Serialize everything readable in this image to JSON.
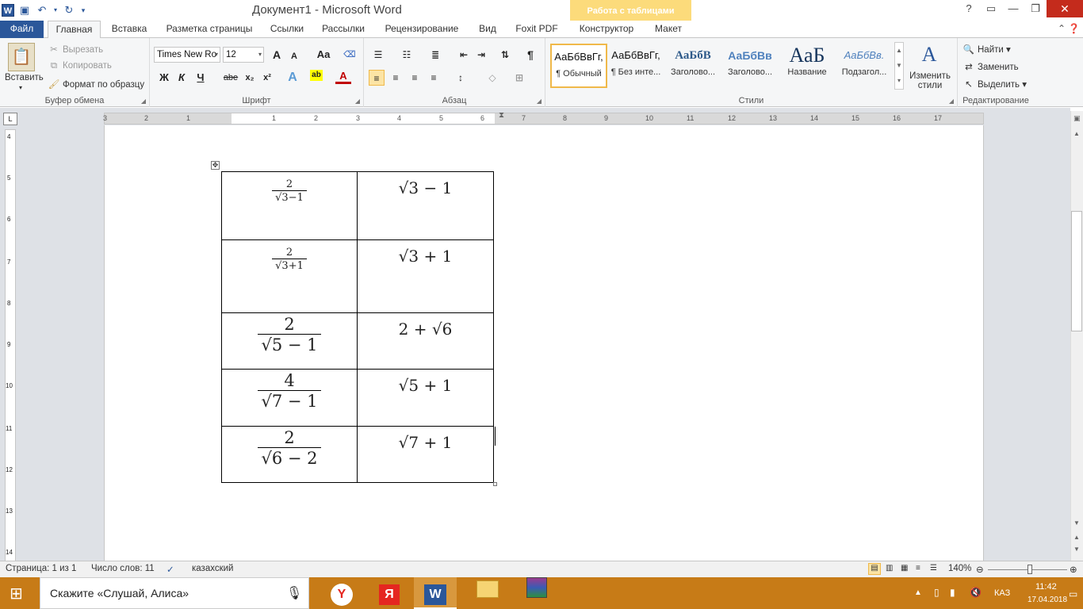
{
  "window": {
    "title": "Документ1 - Microsoft Word",
    "context_tab": "Работа с таблицами"
  },
  "tabs": [
    "Файл",
    "Главная",
    "Вставка",
    "Разметка страницы",
    "Ссылки",
    "Рассылки",
    "Рецензирование",
    "Вид",
    "Foxit PDF",
    "Конструктор",
    "Макет"
  ],
  "clipboard": {
    "paste": "Вставить",
    "cut": "Вырезать",
    "copy": "Копировать",
    "format_painter": "Формат по образцу",
    "label": "Буфер обмена"
  },
  "font": {
    "name": "Times New Ro",
    "size": "12",
    "label": "Шрифт",
    "bold": "Ж",
    "italic": "К",
    "underline": "Ч",
    "strike": "abe",
    "sub": "x₂",
    "sup": "x²",
    "grow": "A",
    "shrink": "A",
    "case": "Aa"
  },
  "paragraph": {
    "label": "Абзац"
  },
  "styles": {
    "label": "Стили",
    "change": "Изменить стили",
    "items": [
      {
        "sample": "АаБбВвГг,",
        "name": "¶ Обычный"
      },
      {
        "sample": "АаБбВвГг,",
        "name": "¶ Без инте..."
      },
      {
        "sample": "АаБбВ",
        "name": "Заголово..."
      },
      {
        "sample": "АаБбВв",
        "name": "Заголово..."
      },
      {
        "sample": "АаБ",
        "name": "Название"
      },
      {
        "sample": "АаБбВв.",
        "name": "Подзагол..."
      }
    ]
  },
  "editing": {
    "label": "Редактирование",
    "find": "Найти",
    "replace": "Заменить",
    "select": "Выделить"
  },
  "ruler_numbers": [
    "3",
    "2",
    "1",
    "1",
    "2",
    "3",
    "4",
    "5",
    "6",
    "7",
    "8",
    "9",
    "10",
    "11",
    "12",
    "13",
    "14",
    "15",
    "16",
    "17"
  ],
  "vruler_numbers": [
    "4",
    "5",
    "6",
    "7",
    "8",
    "9",
    "10",
    "11",
    "12",
    "13",
    "14"
  ],
  "table": [
    {
      "left": {
        "num": "2",
        "den": "√3−1",
        "big": false
      },
      "right": "√3 − 1"
    },
    {
      "left": {
        "num": "2",
        "den": "√3+1",
        "big": false
      },
      "right": "√3 + 1"
    },
    {
      "left": {
        "num": "2",
        "den": "√5 − 1",
        "big": true
      },
      "right": "2 + √6"
    },
    {
      "left": {
        "num": "4",
        "den": "√7 − 1",
        "big": true
      },
      "right": "√5 + 1"
    },
    {
      "left": {
        "num": "2",
        "den": "√6 − 2",
        "big": true
      },
      "right": "√7 + 1"
    }
  ],
  "status": {
    "page": "Страница: 1 из 1",
    "words": "Число слов: 11",
    "lang": "казахский",
    "zoom": "140%"
  },
  "taskbar": {
    "search": "Скажите «Слушай, Алиса»",
    "lang": "КАЗ",
    "time": "11:42",
    "date": "17.04.2018"
  }
}
